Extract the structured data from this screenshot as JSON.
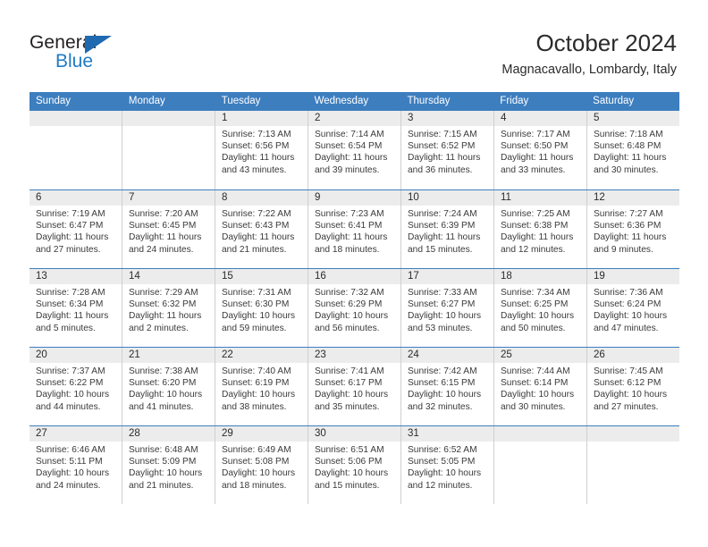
{
  "brand": {
    "name_top": "General",
    "name_bottom": "Blue",
    "triangle_color": "#1f69b0",
    "blue_color": "#1f7bc4"
  },
  "header": {
    "title": "October 2024",
    "subtitle": "Magnacavallo, Lombardy, Italy"
  },
  "theme": {
    "header_blue": "#3d7ebf",
    "day_band_gray": "#ececec",
    "cell_border": "#cfcfcf"
  },
  "weekdays": [
    "Sunday",
    "Monday",
    "Tuesday",
    "Wednesday",
    "Thursday",
    "Friday",
    "Saturday"
  ],
  "weeks": [
    [
      {
        "day": "",
        "sunrise": "",
        "sunset": "",
        "daylight": ""
      },
      {
        "day": "",
        "sunrise": "",
        "sunset": "",
        "daylight": ""
      },
      {
        "day": "1",
        "sunrise": "Sunrise: 7:13 AM",
        "sunset": "Sunset: 6:56 PM",
        "daylight": "Daylight: 11 hours and 43 minutes."
      },
      {
        "day": "2",
        "sunrise": "Sunrise: 7:14 AM",
        "sunset": "Sunset: 6:54 PM",
        "daylight": "Daylight: 11 hours and 39 minutes."
      },
      {
        "day": "3",
        "sunrise": "Sunrise: 7:15 AM",
        "sunset": "Sunset: 6:52 PM",
        "daylight": "Daylight: 11 hours and 36 minutes."
      },
      {
        "day": "4",
        "sunrise": "Sunrise: 7:17 AM",
        "sunset": "Sunset: 6:50 PM",
        "daylight": "Daylight: 11 hours and 33 minutes."
      },
      {
        "day": "5",
        "sunrise": "Sunrise: 7:18 AM",
        "sunset": "Sunset: 6:48 PM",
        "daylight": "Daylight: 11 hours and 30 minutes."
      }
    ],
    [
      {
        "day": "6",
        "sunrise": "Sunrise: 7:19 AM",
        "sunset": "Sunset: 6:47 PM",
        "daylight": "Daylight: 11 hours and 27 minutes."
      },
      {
        "day": "7",
        "sunrise": "Sunrise: 7:20 AM",
        "sunset": "Sunset: 6:45 PM",
        "daylight": "Daylight: 11 hours and 24 minutes."
      },
      {
        "day": "8",
        "sunrise": "Sunrise: 7:22 AM",
        "sunset": "Sunset: 6:43 PM",
        "daylight": "Daylight: 11 hours and 21 minutes."
      },
      {
        "day": "9",
        "sunrise": "Sunrise: 7:23 AM",
        "sunset": "Sunset: 6:41 PM",
        "daylight": "Daylight: 11 hours and 18 minutes."
      },
      {
        "day": "10",
        "sunrise": "Sunrise: 7:24 AM",
        "sunset": "Sunset: 6:39 PM",
        "daylight": "Daylight: 11 hours and 15 minutes."
      },
      {
        "day": "11",
        "sunrise": "Sunrise: 7:25 AM",
        "sunset": "Sunset: 6:38 PM",
        "daylight": "Daylight: 11 hours and 12 minutes."
      },
      {
        "day": "12",
        "sunrise": "Sunrise: 7:27 AM",
        "sunset": "Sunset: 6:36 PM",
        "daylight": "Daylight: 11 hours and 9 minutes."
      }
    ],
    [
      {
        "day": "13",
        "sunrise": "Sunrise: 7:28 AM",
        "sunset": "Sunset: 6:34 PM",
        "daylight": "Daylight: 11 hours and 5 minutes."
      },
      {
        "day": "14",
        "sunrise": "Sunrise: 7:29 AM",
        "sunset": "Sunset: 6:32 PM",
        "daylight": "Daylight: 11 hours and 2 minutes."
      },
      {
        "day": "15",
        "sunrise": "Sunrise: 7:31 AM",
        "sunset": "Sunset: 6:30 PM",
        "daylight": "Daylight: 10 hours and 59 minutes."
      },
      {
        "day": "16",
        "sunrise": "Sunrise: 7:32 AM",
        "sunset": "Sunset: 6:29 PM",
        "daylight": "Daylight: 10 hours and 56 minutes."
      },
      {
        "day": "17",
        "sunrise": "Sunrise: 7:33 AM",
        "sunset": "Sunset: 6:27 PM",
        "daylight": "Daylight: 10 hours and 53 minutes."
      },
      {
        "day": "18",
        "sunrise": "Sunrise: 7:34 AM",
        "sunset": "Sunset: 6:25 PM",
        "daylight": "Daylight: 10 hours and 50 minutes."
      },
      {
        "day": "19",
        "sunrise": "Sunrise: 7:36 AM",
        "sunset": "Sunset: 6:24 PM",
        "daylight": "Daylight: 10 hours and 47 minutes."
      }
    ],
    [
      {
        "day": "20",
        "sunrise": "Sunrise: 7:37 AM",
        "sunset": "Sunset: 6:22 PM",
        "daylight": "Daylight: 10 hours and 44 minutes."
      },
      {
        "day": "21",
        "sunrise": "Sunrise: 7:38 AM",
        "sunset": "Sunset: 6:20 PM",
        "daylight": "Daylight: 10 hours and 41 minutes."
      },
      {
        "day": "22",
        "sunrise": "Sunrise: 7:40 AM",
        "sunset": "Sunset: 6:19 PM",
        "daylight": "Daylight: 10 hours and 38 minutes."
      },
      {
        "day": "23",
        "sunrise": "Sunrise: 7:41 AM",
        "sunset": "Sunset: 6:17 PM",
        "daylight": "Daylight: 10 hours and 35 minutes."
      },
      {
        "day": "24",
        "sunrise": "Sunrise: 7:42 AM",
        "sunset": "Sunset: 6:15 PM",
        "daylight": "Daylight: 10 hours and 32 minutes."
      },
      {
        "day": "25",
        "sunrise": "Sunrise: 7:44 AM",
        "sunset": "Sunset: 6:14 PM",
        "daylight": "Daylight: 10 hours and 30 minutes."
      },
      {
        "day": "26",
        "sunrise": "Sunrise: 7:45 AM",
        "sunset": "Sunset: 6:12 PM",
        "daylight": "Daylight: 10 hours and 27 minutes."
      }
    ],
    [
      {
        "day": "27",
        "sunrise": "Sunrise: 6:46 AM",
        "sunset": "Sunset: 5:11 PM",
        "daylight": "Daylight: 10 hours and 24 minutes."
      },
      {
        "day": "28",
        "sunrise": "Sunrise: 6:48 AM",
        "sunset": "Sunset: 5:09 PM",
        "daylight": "Daylight: 10 hours and 21 minutes."
      },
      {
        "day": "29",
        "sunrise": "Sunrise: 6:49 AM",
        "sunset": "Sunset: 5:08 PM",
        "daylight": "Daylight: 10 hours and 18 minutes."
      },
      {
        "day": "30",
        "sunrise": "Sunrise: 6:51 AM",
        "sunset": "Sunset: 5:06 PM",
        "daylight": "Daylight: 10 hours and 15 minutes."
      },
      {
        "day": "31",
        "sunrise": "Sunrise: 6:52 AM",
        "sunset": "Sunset: 5:05 PM",
        "daylight": "Daylight: 10 hours and 12 minutes."
      },
      {
        "day": "",
        "sunrise": "",
        "sunset": "",
        "daylight": ""
      },
      {
        "day": "",
        "sunrise": "",
        "sunset": "",
        "daylight": ""
      }
    ]
  ]
}
